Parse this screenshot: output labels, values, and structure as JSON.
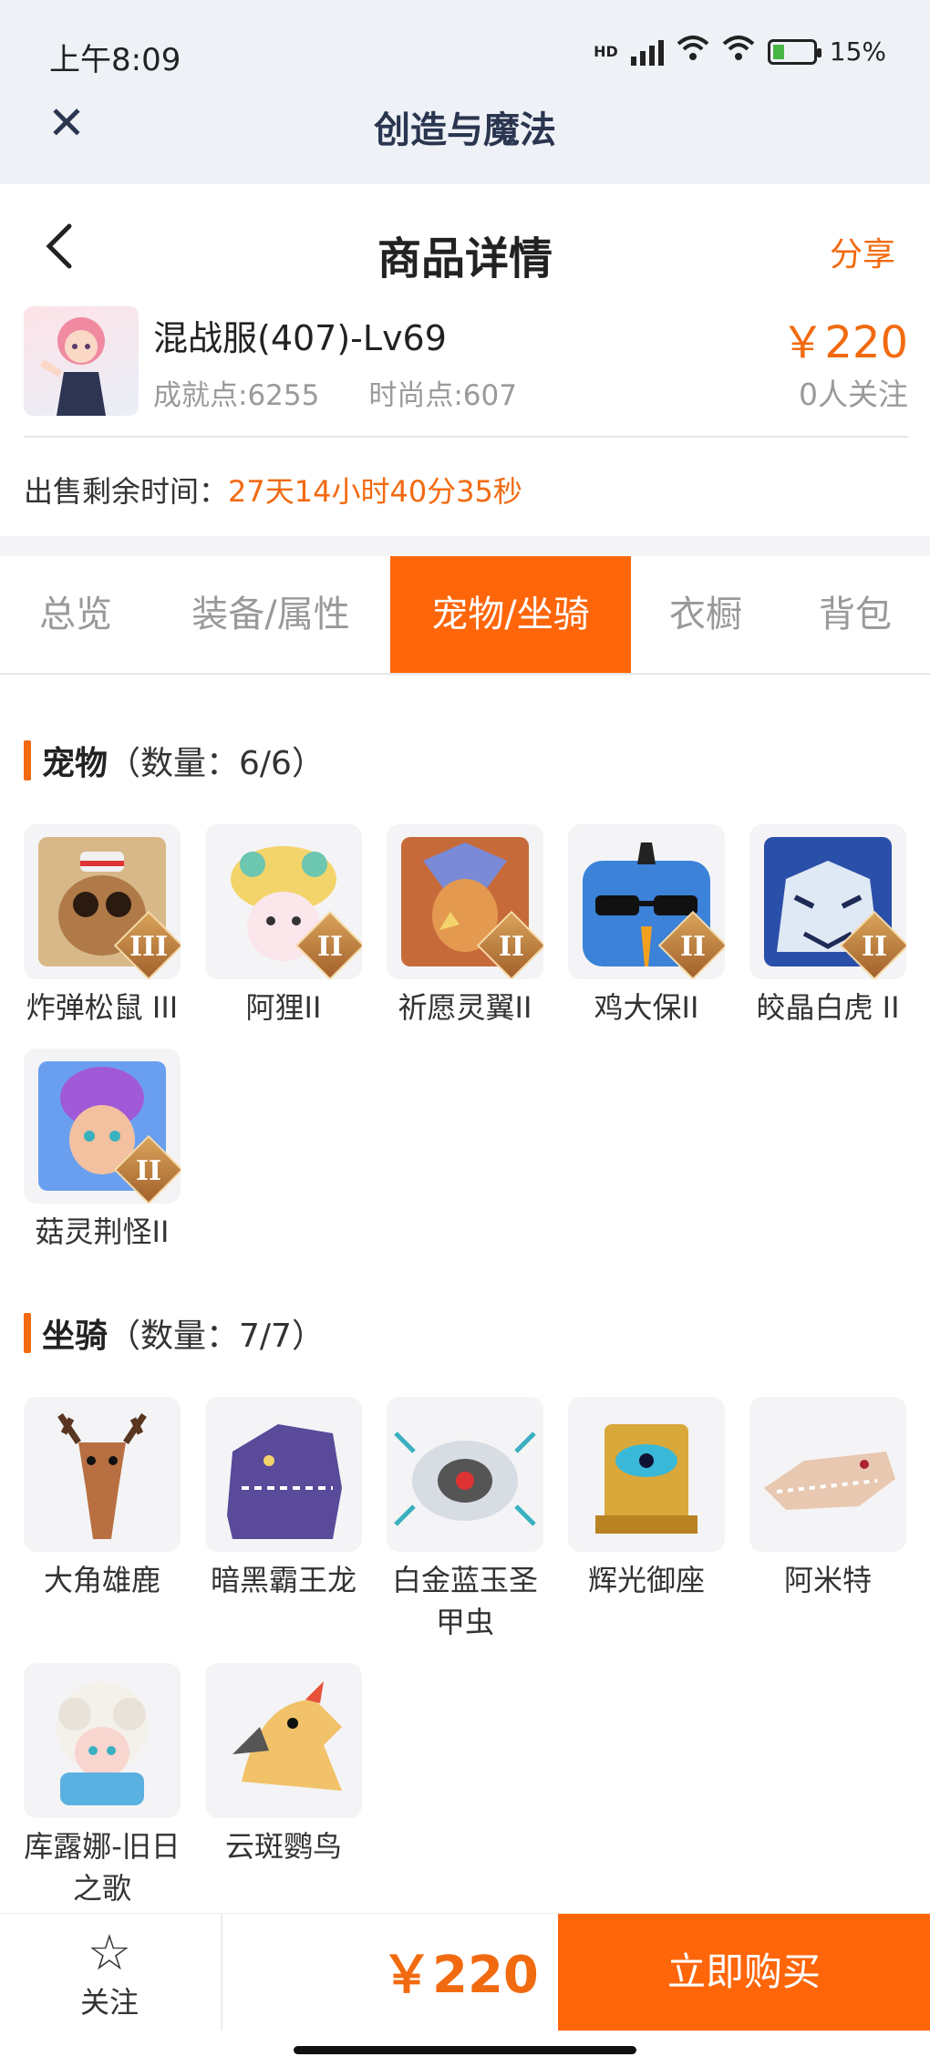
{
  "status_bar": {
    "time": "上午8:09",
    "network": "HD",
    "battery": "15%"
  },
  "app": {
    "title": "创造与魔法"
  },
  "header": {
    "title": "商品详情",
    "share": "分享"
  },
  "product": {
    "name": "混战服(407)-Lv69",
    "achievement": "成就点:6255",
    "fashion": "时尚点:607",
    "price": "￥220",
    "followers": "0人关注"
  },
  "sale": {
    "label": "出售剩余时间：",
    "value": "27天14小时40分35秒"
  },
  "tabs": [
    {
      "label": "总览"
    },
    {
      "label": "装备/属性"
    },
    {
      "label": "宠物/坐骑"
    },
    {
      "label": "衣橱"
    },
    {
      "label": "背包"
    }
  ],
  "pets": {
    "title": "宠物",
    "count": "（数量：6/6）",
    "items": [
      {
        "name": "炸弹松鼠 III",
        "badge": "III"
      },
      {
        "name": "阿狸II",
        "badge": "II"
      },
      {
        "name": "祈愿灵翼II",
        "badge": "II"
      },
      {
        "name": "鸡大保II",
        "badge": "II"
      },
      {
        "name": "皎晶白虎 II",
        "badge": "II"
      },
      {
        "name": "菇灵荆怪II",
        "badge": "II"
      }
    ]
  },
  "mounts": {
    "title": "坐骑",
    "count": "（数量：7/7）",
    "items": [
      {
        "name": "大角雄鹿"
      },
      {
        "name": "暗黑霸王龙"
      },
      {
        "name": "白金蓝玉圣甲虫"
      },
      {
        "name": "辉光御座"
      },
      {
        "name": "阿米特"
      },
      {
        "name": "库露娜-旧日之歌"
      },
      {
        "name": "云斑鹦鸟"
      }
    ]
  },
  "bottom": {
    "follow": "关注",
    "price": "￥220",
    "buy": "立即购买"
  },
  "colors": {
    "accent": "#fe6609",
    "price": "#f26a10"
  }
}
